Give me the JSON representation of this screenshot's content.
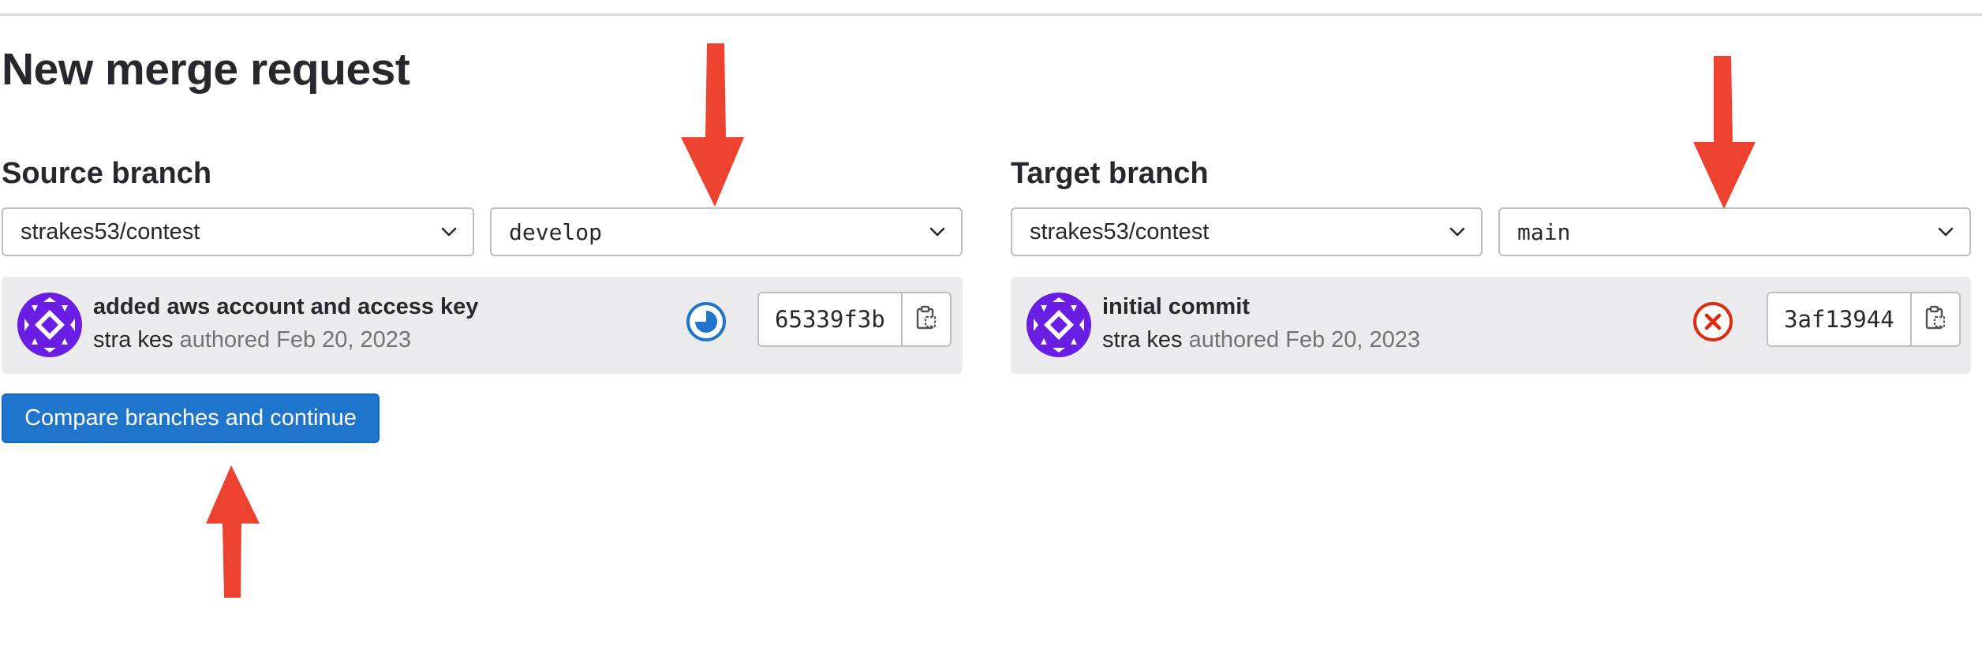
{
  "page": {
    "title": "New merge request"
  },
  "source": {
    "heading": "Source branch",
    "project": "strakes53/contest",
    "branch": "develop",
    "commit": {
      "title": "added aws account and access key",
      "author": "stra kes",
      "authored_text": "authored Feb 20, 2023",
      "sha": "65339f3b",
      "status": "pipeline running",
      "status_icon": "status-running-icon"
    }
  },
  "target": {
    "heading": "Target branch",
    "project": "strakes53/contest",
    "branch": "main",
    "commit": {
      "title": "initial commit",
      "author": "stra kes",
      "authored_text": "authored Feb 20, 2023",
      "sha": "3af13944",
      "status": "pipeline failed",
      "status_icon": "status-failed-icon"
    }
  },
  "actions": {
    "compare_label": "Compare branches and continue"
  },
  "colors": {
    "primary": "#1f75cb",
    "annotation_arrow": "#ee4230",
    "status_running": "#1f75cb",
    "status_failed": "#dd2b0e",
    "avatar": "#6a1de3"
  }
}
